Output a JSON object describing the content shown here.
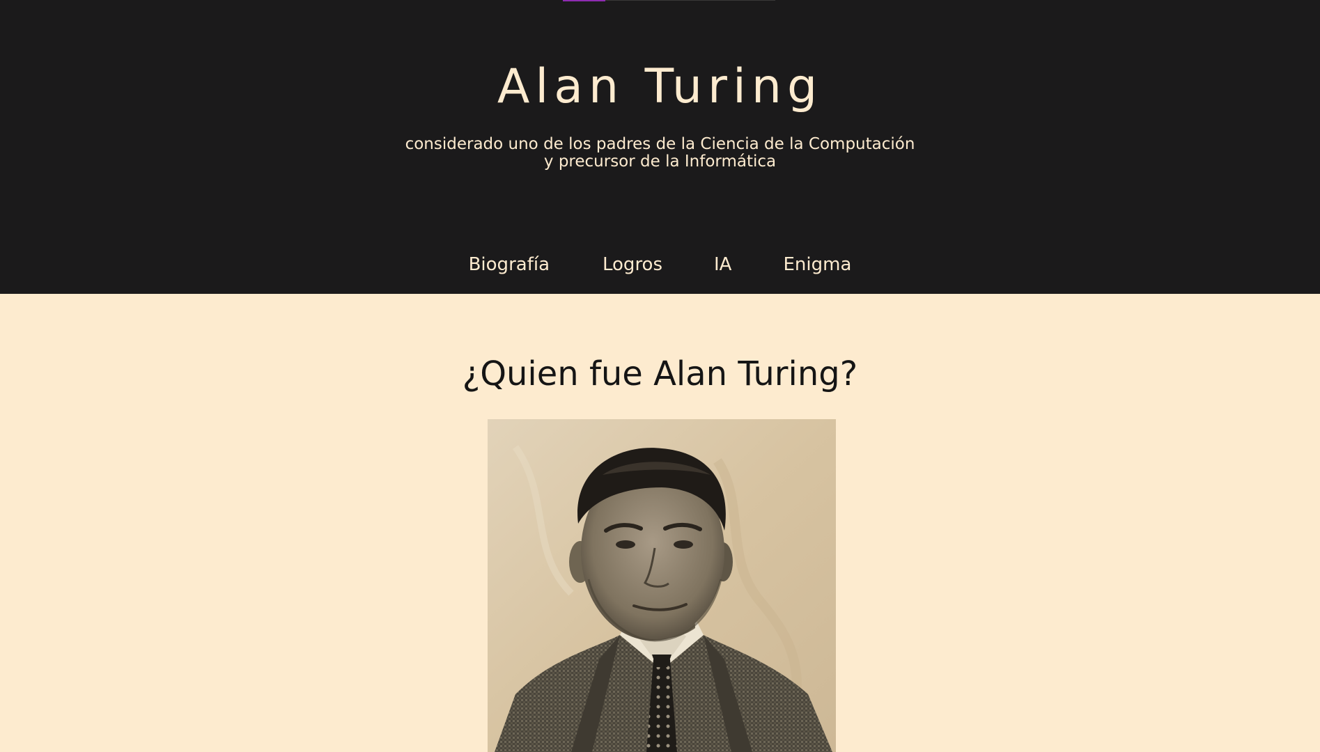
{
  "header": {
    "title": "Alan Turing",
    "subtitle_line1": "considerado uno de los padres de la Ciencia de la Computación",
    "subtitle_line2": "y precursor de la Informática"
  },
  "nav": {
    "items": [
      {
        "label": "Biografía"
      },
      {
        "label": "Logros"
      },
      {
        "label": "IA"
      },
      {
        "label": "Enigma"
      }
    ]
  },
  "main": {
    "heading": "¿Quien fue Alan Turing?",
    "portrait_icon": "portrait-photo"
  },
  "colors": {
    "header_bg": "#1b1a1b",
    "page_bg": "#fdebcf",
    "accent": "#8e2bb1",
    "text_light": "#fdebcf",
    "text_dark": "#151515"
  }
}
